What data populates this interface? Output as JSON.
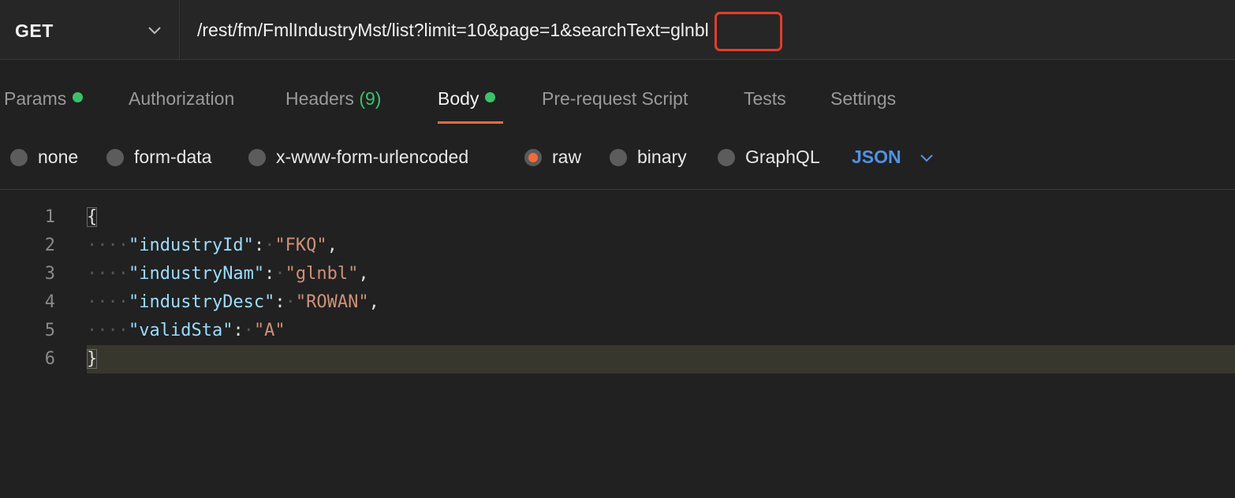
{
  "request": {
    "method": "GET",
    "url": "/rest/fm/FmlIndustryMst/list?limit=10&page=1&searchText=glnbl"
  },
  "tabs": [
    {
      "label": "Params",
      "dot": true
    },
    {
      "label": "Authorization"
    },
    {
      "label": "Headers",
      "count": "(9)"
    },
    {
      "label": "Body",
      "dot": true,
      "active": true
    },
    {
      "label": "Pre-request Script"
    },
    {
      "label": "Tests"
    },
    {
      "label": "Settings"
    }
  ],
  "body_types": [
    {
      "label": "none"
    },
    {
      "label": "form-data"
    },
    {
      "label": "x-www-form-urlencoded"
    },
    {
      "label": "raw",
      "selected": true
    },
    {
      "label": "binary"
    },
    {
      "label": "GraphQL"
    }
  ],
  "language": "JSON",
  "editor": {
    "line_numbers": [
      "1",
      "2",
      "3",
      "4",
      "5",
      "6"
    ],
    "open_brace": "{",
    "close_brace": "}",
    "fields": [
      {
        "key": "\"industryId\"",
        "value": "\"FKQ\"",
        "comma": ","
      },
      {
        "key": "\"industryNam\"",
        "value": "\"glnbl\"",
        "comma": ","
      },
      {
        "key": "\"industryDesc\"",
        "value": "\"ROWAN\"",
        "comma": ","
      },
      {
        "key": "\"validSta\"",
        "value": "\"A\"",
        "comma": ""
      }
    ]
  },
  "colors": {
    "accent": "#f26b3a",
    "highlight_box": "#e23d2d",
    "status_dot": "#3cc16b",
    "language_link": "#4f93e6"
  }
}
